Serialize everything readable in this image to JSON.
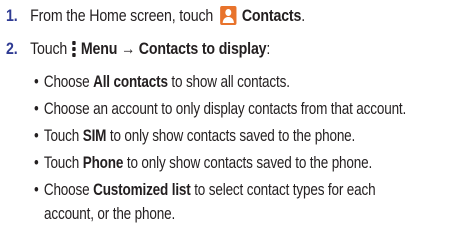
{
  "steps": [
    {
      "number": "1.",
      "before": "From the Home screen, touch",
      "bold": "Contacts",
      "after": "."
    },
    {
      "number": "2.",
      "before": "Touch",
      "bold": "Menu → Contacts to display",
      "after": ":"
    }
  ],
  "icons": {
    "contacts": "contacts-app-icon",
    "menu": "menu-vertical-dots-icon",
    "contacts_color": "#e8732c"
  },
  "bullets": [
    {
      "before": "Choose ",
      "bold": "All contacts",
      "after": " to show all contacts."
    },
    {
      "before": "Choose an account to only display contacts from that account.",
      "bold": "",
      "after": ""
    },
    {
      "before": "Touch ",
      "bold": "SIM",
      "after": " to only show contacts saved to the phone."
    },
    {
      "before": "Touch ",
      "bold": "Phone",
      "after": " to only show contacts saved to the phone."
    },
    {
      "before": "Choose ",
      "bold": "Customized list",
      "after": " to select contact types for each"
    },
    {
      "continuation": "account, or the phone."
    }
  ],
  "bullet_char": "•",
  "colors": {
    "step_number": "#2f3b93",
    "text": "#231f20"
  }
}
